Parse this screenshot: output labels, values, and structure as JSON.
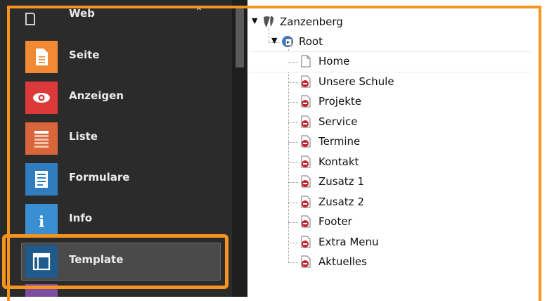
{
  "module_menu": {
    "group_label": "Web",
    "items": [
      {
        "label": "Seite",
        "icon": "page-icon",
        "color": "#f08a34"
      },
      {
        "label": "Anzeigen",
        "icon": "eye-icon",
        "color": "#dc3a3a"
      },
      {
        "label": "Liste",
        "icon": "list-icon",
        "color": "#d9663a"
      },
      {
        "label": "Formulare",
        "icon": "form-icon",
        "color": "#2f7dbf"
      },
      {
        "label": "Info",
        "icon": "info-icon",
        "color": "#3a8fd3"
      },
      {
        "label": "Template",
        "icon": "template-icon",
        "color": "#1e5a8c"
      }
    ],
    "active_item": "Template"
  },
  "page_tree": {
    "site_name": "Zanzenberg",
    "root_label": "Root",
    "pages": [
      "Home",
      "Unsere Schule",
      "Projekte",
      "Service",
      "Termine",
      "Kontakt",
      "Zusatz 1",
      "Zusatz 2",
      "Footer",
      "Extra Menu",
      "Aktuelles"
    ],
    "selected_page": "Home"
  },
  "colors": {
    "highlight": "#f5941e",
    "sidebar_bg": "#2b2b2b",
    "hidden_badge": "#c8232d"
  }
}
